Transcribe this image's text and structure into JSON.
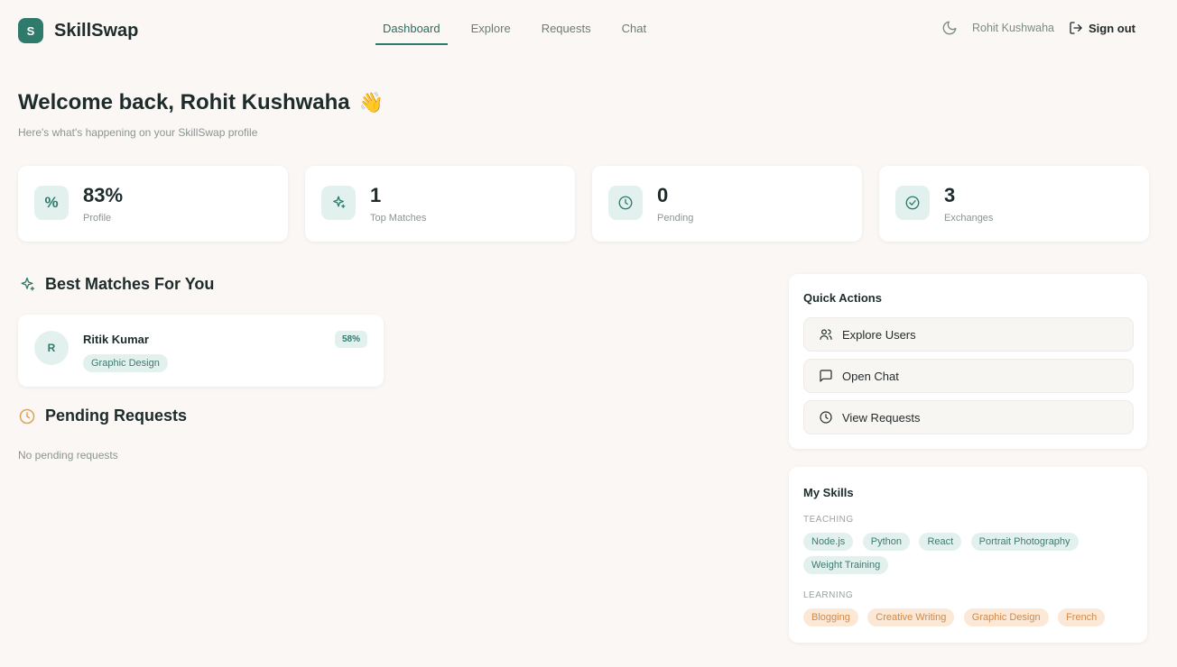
{
  "brand": {
    "logo_letter": "S",
    "name": "SkillSwap"
  },
  "nav": {
    "items": [
      {
        "label": "Dashboard",
        "active": true
      },
      {
        "label": "Explore",
        "active": false
      },
      {
        "label": "Requests",
        "active": false
      },
      {
        "label": "Chat",
        "active": false
      }
    ]
  },
  "header": {
    "user_name": "Rohit Kushwaha",
    "signout_label": "Sign out"
  },
  "welcome": {
    "title": "Welcome back, Rohit Kushwaha",
    "emoji": "👋",
    "subtitle": "Here's what's happening on your SkillSwap profile"
  },
  "stats": [
    {
      "icon": "percent-icon",
      "value": "83%",
      "label": "Profile"
    },
    {
      "icon": "sparkles-icon",
      "value": "1",
      "label": "Top Matches"
    },
    {
      "icon": "clock-icon",
      "value": "0",
      "label": "Pending"
    },
    {
      "icon": "check-circle-icon",
      "value": "3",
      "label": "Exchanges"
    }
  ],
  "best_matches": {
    "title": "Best Matches For You",
    "items": [
      {
        "initial": "R",
        "name": "Ritik Kumar",
        "score": "58%",
        "tag": "Graphic Design"
      }
    ]
  },
  "pending": {
    "title": "Pending Requests",
    "empty_text": "No pending requests"
  },
  "quick_actions": {
    "title": "Quick Actions",
    "items": [
      {
        "icon": "users-icon",
        "label": "Explore Users"
      },
      {
        "icon": "message-square-icon",
        "label": "Open Chat"
      },
      {
        "icon": "clock-icon",
        "label": "View Requests"
      }
    ]
  },
  "my_skills": {
    "title": "My Skills",
    "teaching_label": "TEACHING",
    "teaching": [
      "Node.js",
      "Python",
      "React",
      "Portrait Photography",
      "Weight Training"
    ],
    "learning_label": "LEARNING",
    "learning": [
      "Blogging",
      "Creative Writing",
      "Graphic Design",
      "French"
    ]
  },
  "colors": {
    "accent": "#2f7a6b",
    "learning_accent": "#d18a4a",
    "background": "#faf7f4"
  }
}
